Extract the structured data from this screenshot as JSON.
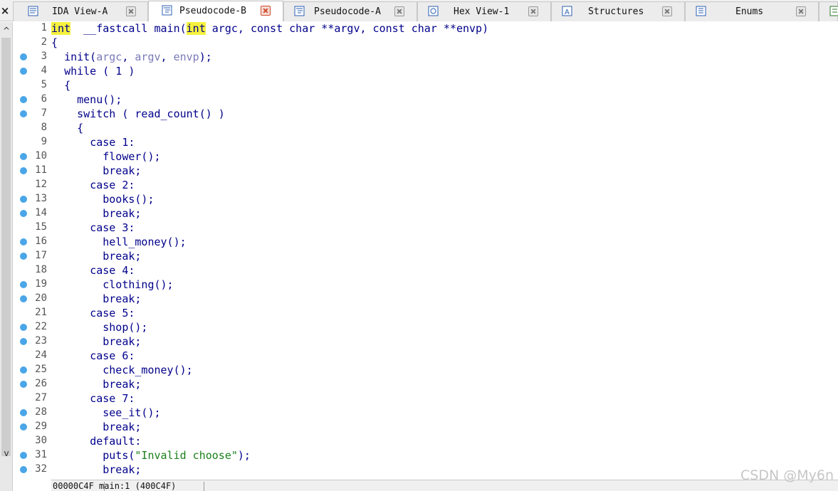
{
  "tabs": [
    {
      "label": "IDA View-A",
      "active": false,
      "close_red": false
    },
    {
      "label": "Pseudocode-B",
      "active": true,
      "close_red": true
    },
    {
      "label": "Pseudocode-A",
      "active": false,
      "close_red": false
    },
    {
      "label": "Hex View-1",
      "active": false,
      "close_red": false
    },
    {
      "label": "Structures",
      "active": false,
      "close_red": false
    },
    {
      "label": "Enums",
      "active": false,
      "close_red": false
    }
  ],
  "window_close_glyph": "×",
  "scroll": {
    "up_glyph": "^",
    "down_glyph": "v"
  },
  "code": {
    "line_numbers": [
      "1",
      "2",
      "3",
      "4",
      "5",
      "6",
      "7",
      "8",
      "9",
      "10",
      "11",
      "12",
      "13",
      "14",
      "15",
      "16",
      "17",
      "18",
      "19",
      "20",
      "21",
      "22",
      "23",
      "24",
      "25",
      "26",
      "27",
      "28",
      "29",
      "30",
      "31",
      "32"
    ],
    "breakpoint_lines": [
      3,
      4,
      6,
      7,
      10,
      11,
      13,
      14,
      16,
      17,
      19,
      20,
      22,
      23,
      25,
      26,
      28,
      29,
      31,
      32
    ],
    "lines": [
      {
        "indent": "",
        "parts": [
          [
            "hl",
            "int"
          ],
          [
            "",
            "  __fastcall main("
          ],
          [
            "hl",
            "int"
          ],
          [
            "",
            " argc, const char **argv, const char **envp)"
          ]
        ]
      },
      {
        "indent": "",
        "parts": [
          [
            "",
            "{"
          ]
        ]
      },
      {
        "indent": "  ",
        "parts": [
          [
            "",
            "init("
          ],
          [
            "var",
            "argc"
          ],
          [
            "",
            ", "
          ],
          [
            "var",
            "argv"
          ],
          [
            "",
            ", "
          ],
          [
            "var",
            "envp"
          ],
          [
            "",
            ");"
          ]
        ]
      },
      {
        "indent": "  ",
        "parts": [
          [
            "",
            "while ( 1 )"
          ]
        ]
      },
      {
        "indent": "  ",
        "parts": [
          [
            "",
            "{"
          ]
        ]
      },
      {
        "indent": "    ",
        "parts": [
          [
            "",
            "menu();"
          ]
        ]
      },
      {
        "indent": "    ",
        "parts": [
          [
            "",
            "switch ( read_count() )"
          ]
        ]
      },
      {
        "indent": "    ",
        "parts": [
          [
            "",
            "{"
          ]
        ]
      },
      {
        "indent": "      ",
        "parts": [
          [
            "",
            "case 1:"
          ]
        ]
      },
      {
        "indent": "        ",
        "parts": [
          [
            "",
            "flower();"
          ]
        ]
      },
      {
        "indent": "        ",
        "parts": [
          [
            "",
            "break;"
          ]
        ]
      },
      {
        "indent": "      ",
        "parts": [
          [
            "",
            "case 2:"
          ]
        ]
      },
      {
        "indent": "        ",
        "parts": [
          [
            "",
            "books();"
          ]
        ]
      },
      {
        "indent": "        ",
        "parts": [
          [
            "",
            "break;"
          ]
        ]
      },
      {
        "indent": "      ",
        "parts": [
          [
            "",
            "case 3:"
          ]
        ]
      },
      {
        "indent": "        ",
        "parts": [
          [
            "",
            "hell_money();"
          ]
        ]
      },
      {
        "indent": "        ",
        "parts": [
          [
            "",
            "break;"
          ]
        ]
      },
      {
        "indent": "      ",
        "parts": [
          [
            "",
            "case 4:"
          ]
        ]
      },
      {
        "indent": "        ",
        "parts": [
          [
            "",
            "clothing();"
          ]
        ]
      },
      {
        "indent": "        ",
        "parts": [
          [
            "",
            "break;"
          ]
        ]
      },
      {
        "indent": "      ",
        "parts": [
          [
            "",
            "case 5:"
          ]
        ]
      },
      {
        "indent": "        ",
        "parts": [
          [
            "",
            "shop();"
          ]
        ]
      },
      {
        "indent": "        ",
        "parts": [
          [
            "",
            "break;"
          ]
        ]
      },
      {
        "indent": "      ",
        "parts": [
          [
            "",
            "case 6:"
          ]
        ]
      },
      {
        "indent": "        ",
        "parts": [
          [
            "",
            "check_money();"
          ]
        ]
      },
      {
        "indent": "        ",
        "parts": [
          [
            "",
            "break;"
          ]
        ]
      },
      {
        "indent": "      ",
        "parts": [
          [
            "",
            "case 7:"
          ]
        ]
      },
      {
        "indent": "        ",
        "parts": [
          [
            "",
            "see_it();"
          ]
        ]
      },
      {
        "indent": "        ",
        "parts": [
          [
            "",
            "break;"
          ]
        ]
      },
      {
        "indent": "      ",
        "parts": [
          [
            "",
            "default:"
          ]
        ]
      },
      {
        "indent": "        ",
        "parts": [
          [
            "",
            "puts("
          ],
          [
            "str",
            "\"Invalid choose\""
          ],
          [
            "",
            ");"
          ]
        ]
      },
      {
        "indent": "        ",
        "parts": [
          [
            "",
            "break;"
          ]
        ]
      }
    ]
  },
  "status": {
    "text": "00000C4F main:1 (400C4F)"
  },
  "watermark": "CSDN @My6n",
  "colors": {
    "keyword_highlight": "#f5f23d",
    "code_text": "#00008b",
    "variable": "#7a7ab8",
    "string": "#1a7f1a",
    "breakpoint": "#4aa6e8"
  }
}
